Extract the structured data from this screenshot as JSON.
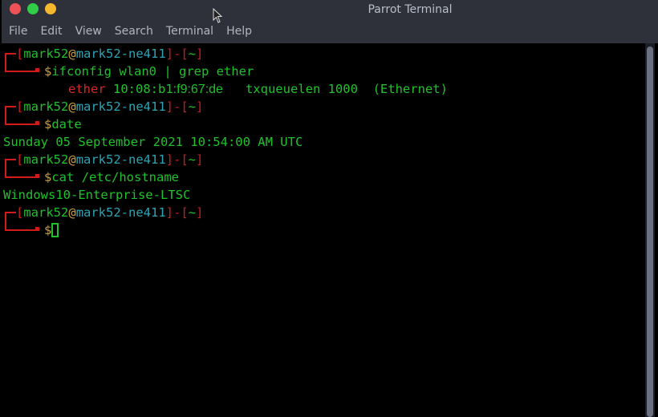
{
  "window": {
    "title": "Parrot Terminal",
    "menu": [
      "File",
      "Edit",
      "View",
      "Search",
      "Terminal",
      "Help"
    ]
  },
  "prompt": {
    "user": "mark52",
    "at": "@",
    "host": "mark52-ne411",
    "dir": "~",
    "symbol": "$"
  },
  "session": [
    {
      "command": "ifconfig wlan0 | grep ether",
      "output": {
        "label": "ether",
        "mac_prefix": "10:08:b1",
        "mac_suffix": ":f9:67:de",
        "rest": "txqueuelen 1000  (Ethernet)"
      }
    },
    {
      "command": "date",
      "output_text": "Sunday 05 September 2021 10:54:00 AM UTC"
    },
    {
      "command": "cat /etc/hostname",
      "output_text": "Windows10-Enterprise-LTSC"
    },
    {
      "command": ""
    }
  ],
  "colors": {
    "titlebar": "#2e313a",
    "prompt_red": "#d11a1a",
    "text_green": "#1ec22a",
    "host_cyan": "#2ea3b5",
    "at_gold": "#c8a23a"
  }
}
